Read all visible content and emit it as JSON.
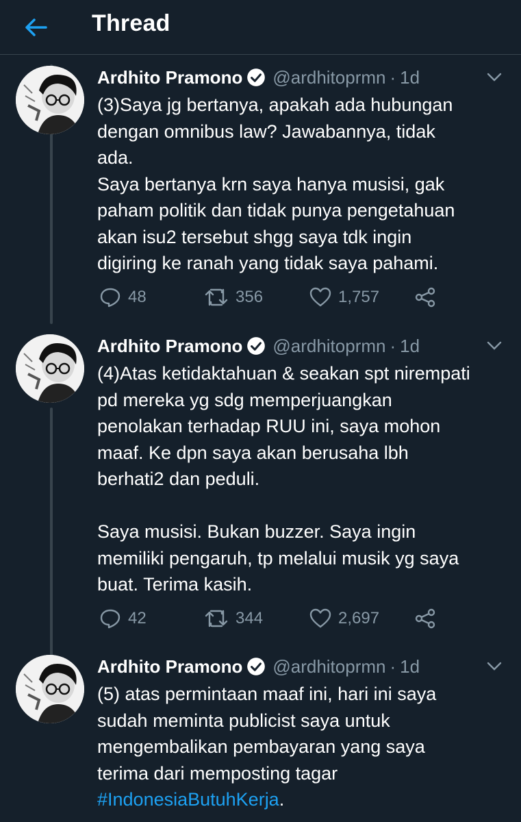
{
  "header": {
    "title": "Thread"
  },
  "tweets": [
    {
      "name": "Ardhito Pramono",
      "handle": "@ardhitoprmn",
      "dot": "·",
      "time": "1d",
      "text": "(3)Saya jg bertanya, apakah ada hubungan\ndengan omnibus law? Jawabannya, tidak\nada.\nSaya bertanya krn saya hanya musisi, gak\npaham politik dan tidak punya pengetahuan\nakan isu2 tersebut shgg saya tdk ingin\ndigiring ke ranah yang tidak saya pahami.",
      "replies": "48",
      "retweets": "356",
      "likes": "1,757"
    },
    {
      "name": "Ardhito Pramono",
      "handle": "@ardhitoprmn",
      "dot": "·",
      "time": "1d",
      "text": "(4)Atas ketidaktahuan & seakan spt nirempati\npd mereka yg sdg memperjuangkan\npenolakan terhadap RUU ini, saya mohon\nmaaf. Ke dpn saya akan berusaha lbh\nberhati2 dan peduli.\n\nSaya musisi. Bukan buzzer. Saya ingin\nmemiliki pengaruh, tp melalui musik yg saya\nbuat. Terima kasih.",
      "replies": "42",
      "retweets": "344",
      "likes": "2,697"
    },
    {
      "name": "Ardhito Pramono",
      "handle": "@ardhitoprmn",
      "dot": "·",
      "time": "1d",
      "text": "(5) atas permintaan maaf ini, hari ini saya\nsudah meminta publicist saya untuk\nmengembalikan pembayaran yang saya\nterima dari memposting tagar\n",
      "hashtag": "#IndonesiaButuhKerja",
      "text_end": "."
    }
  ],
  "colors": {
    "background": "#15202b",
    "accent": "#1da1f2",
    "secondary": "#8899a6"
  }
}
